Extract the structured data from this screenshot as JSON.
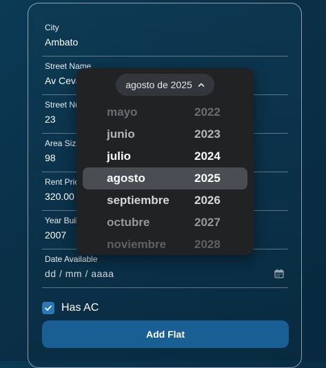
{
  "form": {
    "fields": [
      {
        "label": "City",
        "value": "Ambato"
      },
      {
        "label": "Street Name",
        "value": "Av Cevallos"
      },
      {
        "label": "Street Number",
        "value": "23"
      },
      {
        "label": "Area Size",
        "value": "98"
      },
      {
        "label": "Rent Price",
        "value": "320.00"
      },
      {
        "label": "Year Built",
        "value": "2007"
      }
    ],
    "date": {
      "label": "Date Available",
      "placeholder": "dd / mm / aaaa"
    },
    "checkbox": {
      "label": "Has AC",
      "checked": true
    },
    "submit_label": "Add Flat"
  },
  "picker": {
    "header": "agosto de 2025",
    "months": [
      "mayo",
      "junio",
      "julio",
      "agosto",
      "septiembre",
      "octubre",
      "noviembre"
    ],
    "years": [
      "2022",
      "2023",
      "2024",
      "2025",
      "2026",
      "2027",
      "2028"
    ],
    "selected_month": "agosto",
    "selected_year": "2025"
  },
  "colors": {
    "accent": "#1a5f93",
    "checkbox": "#2b77b8",
    "picker_bg": "#202224"
  }
}
